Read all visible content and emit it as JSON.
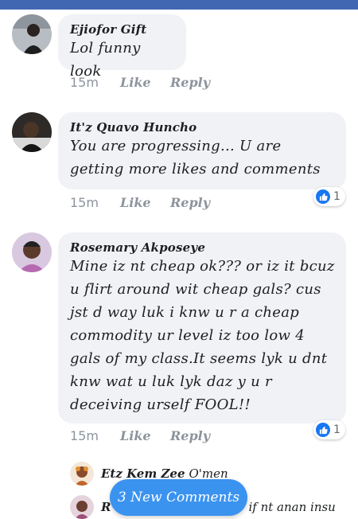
{
  "comments": [
    {
      "author": "Ejiofor Gift",
      "text": "Lol funny look",
      "time": "15m",
      "like_label": "Like",
      "reply_label": "Reply",
      "reactions": null
    },
    {
      "author": "It'z Quavo Huncho",
      "text": "You are progressing... U are getting more likes and comments",
      "time": "15m",
      "like_label": "Like",
      "reply_label": "Reply",
      "reactions": "1"
    },
    {
      "author": "Rosemary Akposeye",
      "text": "Mine iz nt cheap ok??? or iz it bcuz u flirt around wit cheap gals? cus jst d way luk i knw u r a cheap commodity ur level iz too low 4 gals of my class.It seems lyk u dnt knw wat u luk lyk daz y u r deceiving urself FOOL!!",
      "time": "15m",
      "like_label": "Like",
      "reply_label": "Reply",
      "reactions": "1"
    }
  ],
  "replies": [
    {
      "author": "Etz Kem Zee",
      "text": "O'men"
    },
    {
      "author": "R",
      "text": "if nt anan insu"
    }
  ],
  "new_comments_button": "3 New Comments",
  "colors": {
    "header": "#4267b2",
    "bubble": "#f0f2f5",
    "like_blue": "#1877f2",
    "button": "#3b93f0"
  }
}
